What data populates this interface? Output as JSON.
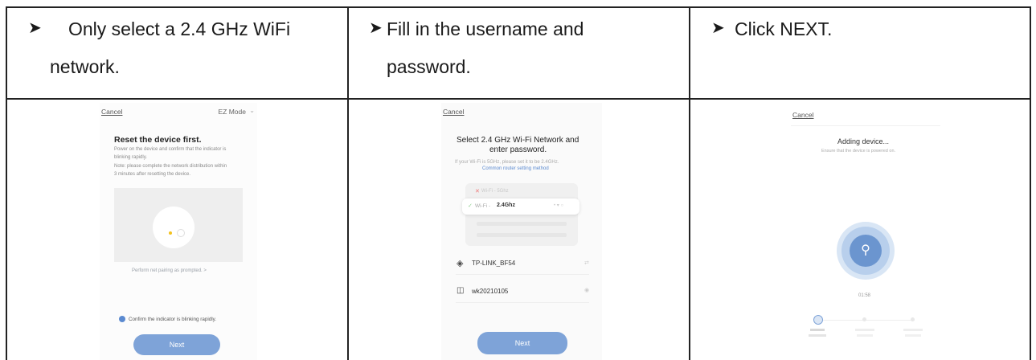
{
  "colors": {
    "accent": "#7ea3d8",
    "border": "#222222",
    "link": "#5b8ad0"
  },
  "instructions": {
    "col1": {
      "line1": "Only select a 2.4 GHz WiFi",
      "line2": "network."
    },
    "col2": {
      "line1": "Fill in the username and",
      "line2": "password."
    },
    "col3": {
      "line1": "Click NEXT."
    }
  },
  "screen1": {
    "cancel": "Cancel",
    "mode": "EZ Mode",
    "title": "Reset the device first.",
    "desc1": "Power on the device and confirm that the indicator is",
    "desc2": "blinking rapidly.",
    "desc3": "Note: please complete the network distribution within",
    "desc4": "3 minutes after resetting the device.",
    "pairing_link": "Perform net pairing as prompted. >",
    "confirm": "Confirm the indicator is blinking rapidly.",
    "next": "Next"
  },
  "screen2": {
    "cancel": "Cancel",
    "title1": "Select 2.4 GHz Wi-Fi Network and",
    "title2": "enter password.",
    "hint": "If your Wi-Fi is 5GHz, please set it to be 2.4GHz.",
    "hint_link": "Common router setting method",
    "wifi_5g": "Wi-Fi - 5Ghz",
    "wifi_24_prefix": "Wi-Fi - ",
    "wifi_24": "2.4Ghz",
    "network": "TP-LINK_BF54",
    "password": "wk20210105",
    "next": "Next"
  },
  "screen3": {
    "cancel": "Cancel",
    "title": "Adding device...",
    "subtitle": "Ensure that the device is powered on.",
    "timer": "01:58"
  }
}
